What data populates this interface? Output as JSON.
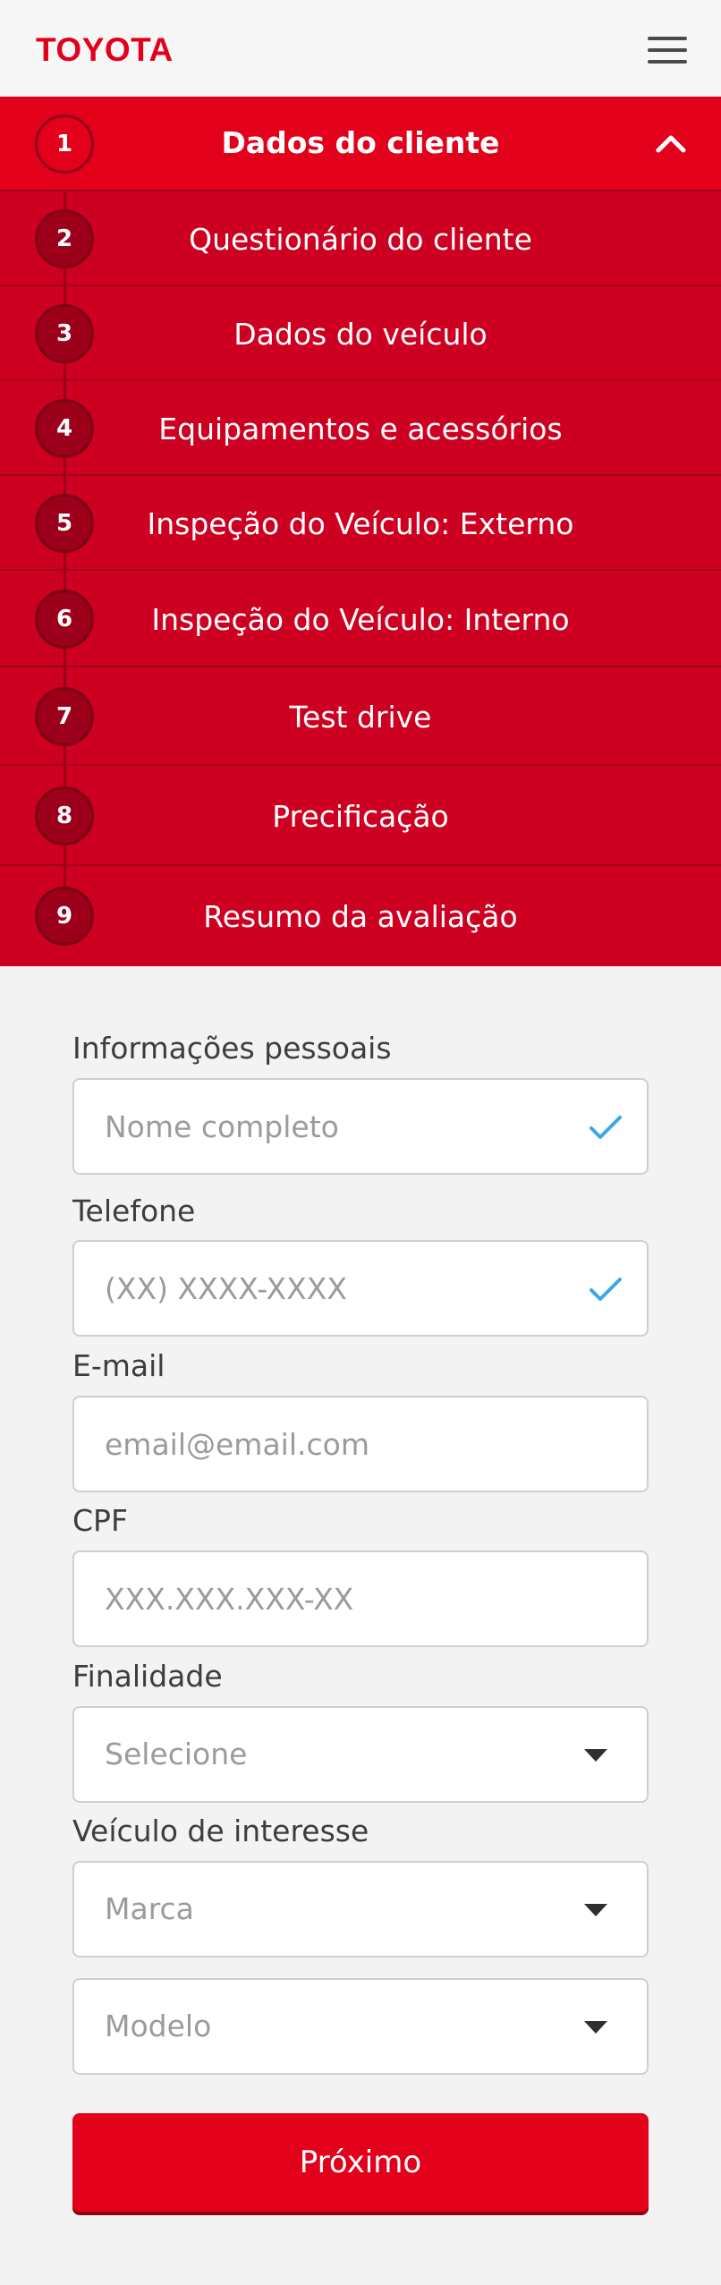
{
  "header": {
    "logo_text": "TOYOTA",
    "menu_icon": "hamburger-menu-icon"
  },
  "steps": [
    {
      "number": "1",
      "label": "Dados do cliente",
      "active": true
    },
    {
      "number": "2",
      "label": "Questionário do cliente",
      "active": false
    },
    {
      "number": "3",
      "label": "Dados do veículo",
      "active": false
    },
    {
      "number": "4",
      "label": "Equipamentos e acessórios",
      "active": false
    },
    {
      "number": "5",
      "label": "Inspeção do Veículo: Externo",
      "active": false
    },
    {
      "number": "6",
      "label": "Inspeção do Veículo: Interno",
      "active": false
    },
    {
      "number": "7",
      "label": "Test drive",
      "active": false
    },
    {
      "number": "8",
      "label": "Precificação",
      "active": false
    },
    {
      "number": "9",
      "label": "Resumo da avaliação",
      "active": false
    }
  ],
  "form": {
    "personal_label": "Informações pessoais",
    "name_placeholder": "Nome completo",
    "phone_label": "Telefone",
    "phone_placeholder": "(XX) XXXX-XXXX",
    "email_label": "E-mail",
    "email_placeholder": "email@email.com",
    "cpf_label": "CPF",
    "cpf_placeholder": "XXX.XXX.XXX-XX",
    "purpose_label": "Finalidade",
    "purpose_value": "Selecione",
    "vehicle_label": "Veículo de interesse",
    "brand_value": "Marca",
    "model_value": "Modelo",
    "next_label": "Próximo"
  },
  "colors": {
    "brand_red": "#e3001b",
    "step_red": "#cd0021",
    "check_blue": "#3aa8e6"
  }
}
